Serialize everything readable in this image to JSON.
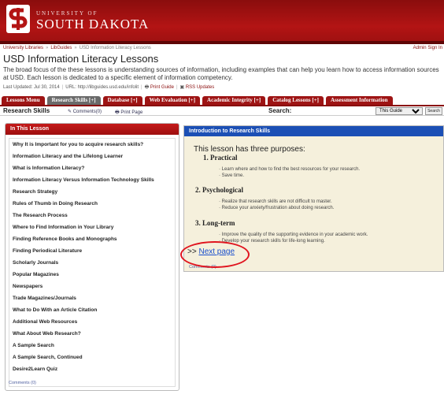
{
  "header": {
    "university_top": "UNIVERSITY OF",
    "university_name": "SOUTH DAKOTA"
  },
  "breadcrumb": {
    "items": [
      "University Libraries",
      "LibGuides",
      "USD Information Literacy Lessons"
    ],
    "admin_link": "Admin Sign In"
  },
  "page": {
    "title": "USD Information Literacy Lessons",
    "description": "The broad focus of the these lessons is understanding sources of information, including examples that can help you learn how to access information sources at USD. Each lesson is dedicated to a specific element of information competency.",
    "last_updated": "Last Updated: Jul 30, 2014",
    "url": "URL: http://libguides.usd.edu/infolit",
    "print_guide": "Print Guide",
    "rss": "RSS Updates"
  },
  "tabs": [
    {
      "label": "Lessons Menu"
    },
    {
      "label": "Research Skills [+]"
    },
    {
      "label": "Database [+]"
    },
    {
      "label": "Web Evaluation [+]"
    },
    {
      "label": "Academic Integrity [+]"
    },
    {
      "label": "Catalog Lessons [+]"
    },
    {
      "label": "Assessment Information"
    }
  ],
  "subbar": {
    "guide_title": "Research Skills",
    "comments": "Comments(0)",
    "print_page": "Print Page",
    "search_label": "Search:",
    "search_scope": "This Guide",
    "search_button": "Search"
  },
  "left_panel": {
    "title": "In This Lesson",
    "items": [
      "Why It is Important for you to acquire research skills?",
      "Information Literacy and the Lifelong Learner",
      "What is Information Literacy?",
      "Information Literacy Versus Information Technology Skills",
      "Research Strategy",
      "Rules of Thumb in Doing Research",
      "The Research Process",
      "Where to Find Information in Your Library",
      "Finding Reference Books and Monographs",
      "Finding Periodical Literature",
      "Scholarly Journals",
      "Popular Magazines",
      "Newspapers",
      "Trade Magazines/Journals",
      "What to Do With an Article Citation",
      "Additional Web Resources",
      "What About Web Research?",
      "A Sample Search",
      "A Sample Search, Continued",
      "Desire2Learn Quiz"
    ],
    "comments": "Comments (0)"
  },
  "right_panel": {
    "title": "Introduction to Research Skills",
    "purposes_heading": "This lesson has three purposes:",
    "sections": [
      {
        "heading": "1. Practical",
        "bullets": [
          "Learn where and how to find the best resources for your research.",
          "Save time."
        ]
      },
      {
        "heading": "2. Psychological",
        "bullets": [
          "Realize that research skills are not difficult to master.",
          "Reduce your anxiety/frustration about doing research."
        ]
      },
      {
        "heading": "3. Long-term",
        "bullets": [
          "Improve the quality of the supporting evidence in your academic work.",
          "Develop your research skills for life-long learning."
        ]
      }
    ],
    "next_prefix": ">>",
    "next_label": "Next page",
    "comments": "Comments (0)"
  },
  "colors": {
    "brand_red": "#9e1414",
    "header_blue": "#1b4fb5",
    "highlight_circle": "#e0151f"
  }
}
